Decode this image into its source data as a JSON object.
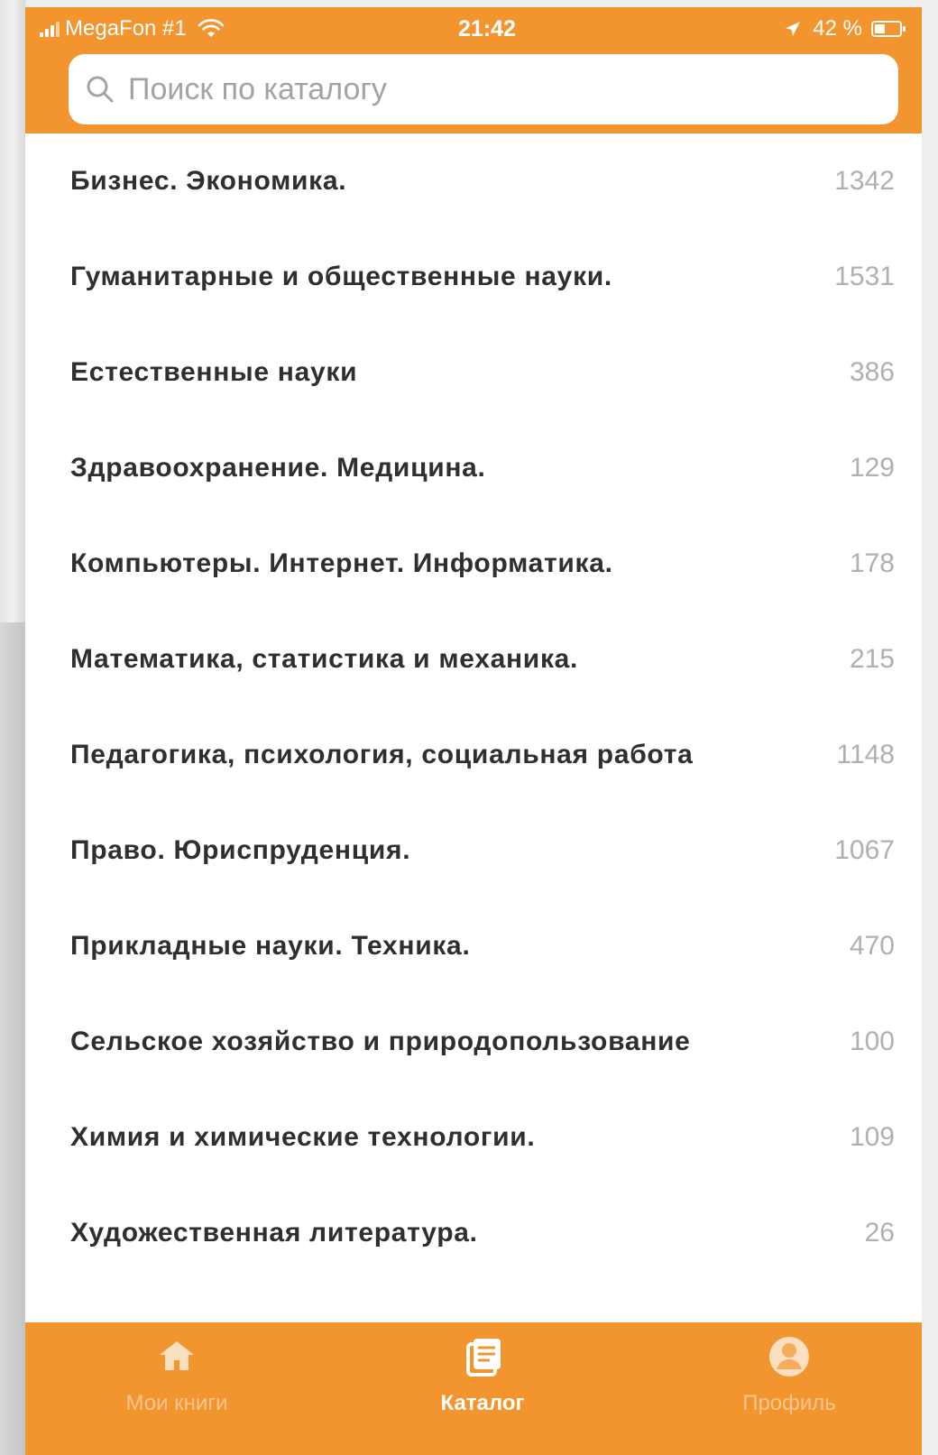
{
  "status_bar": {
    "carrier": "MegaFon #1",
    "time": "21:42",
    "battery_text": "42 %",
    "battery_level": 0.42
  },
  "search": {
    "placeholder": "Поиск по каталогу",
    "value": ""
  },
  "catalog": [
    {
      "label": "Бизнес. Экономика.",
      "count": "1342"
    },
    {
      "label": "Гуманитарные и общественные науки.",
      "count": "1531"
    },
    {
      "label": "Естественные науки",
      "count": "386"
    },
    {
      "label": "Здравоохранение. Медицина.",
      "count": "129"
    },
    {
      "label": "Компьютеры. Интернет. Информатика.",
      "count": "178"
    },
    {
      "label": "Математика, статистика и механика.",
      "count": "215"
    },
    {
      "label": "Педагогика, психология, социальная работа",
      "count": "1148"
    },
    {
      "label": "Право. Юриспруденция.",
      "count": "1067"
    },
    {
      "label": "Прикладные науки. Техника.",
      "count": "470"
    },
    {
      "label": "Сельское хозяйство и природопользование",
      "count": "100"
    },
    {
      "label": "Химия и химические технологии.",
      "count": "109"
    },
    {
      "label": "Художественная литература.",
      "count": "26"
    }
  ],
  "bottom_nav": {
    "items": [
      {
        "label": "Мои книги",
        "icon": "home-icon"
      },
      {
        "label": "Каталог",
        "icon": "catalog-icon"
      },
      {
        "label": "Профиль",
        "icon": "profile-icon"
      }
    ],
    "active": "Каталог"
  },
  "colors": {
    "accent": "#f2952f",
    "text": "#2f2f2f",
    "count": "#b0b0b0",
    "active_nav": "#ffffff",
    "inactive_nav": "#ffc68e"
  }
}
